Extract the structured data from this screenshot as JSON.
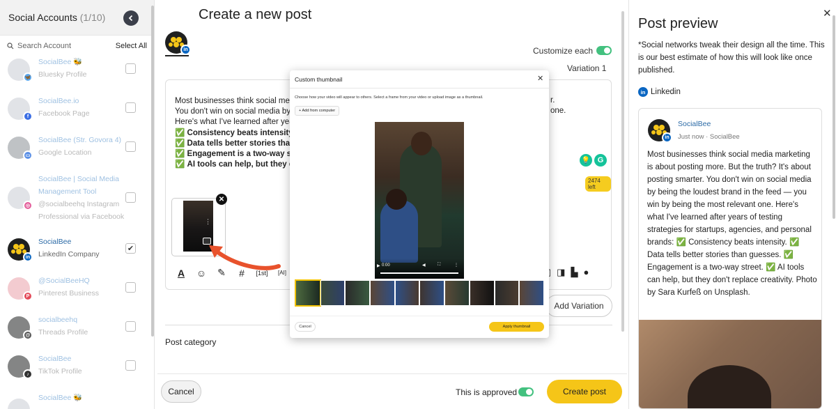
{
  "sidebar": {
    "title": "Social Accounts",
    "count": "(1/10)",
    "search_placeholder": "Search Account",
    "select_all": "Select All",
    "accounts": [
      {
        "name": "SocialBee 🐝",
        "sub": "Bluesky Profile",
        "checked": false,
        "network": "bluesky",
        "network_color": "#5aa7ee"
      },
      {
        "name": "SocialBee.io",
        "sub": "Facebook Page",
        "checked": false,
        "network": "facebook",
        "network_color": "#3b6ee4"
      },
      {
        "name": "SocialBee (Str. Govora 4)",
        "sub": "Google Location",
        "checked": false,
        "network": "google-business",
        "network_color": "#5a8fe6"
      },
      {
        "name": "SocialBee | Social Media Management Tool",
        "sub": "@socialbeehq Instagram Professional via Facebook",
        "checked": false,
        "network": "instagram",
        "network_color": "#e35c9a"
      },
      {
        "name": "SocialBee",
        "sub": "LinkedIn Company",
        "checked": true,
        "network": "linkedin",
        "network_color": "#0a66c2",
        "glyph": "in"
      },
      {
        "name": "@SocialBeeHQ",
        "sub": "Pinterest Business",
        "checked": false,
        "network": "pinterest",
        "network_color": "#e34b5a",
        "glyph": "P"
      },
      {
        "name": "socialbeehq",
        "sub": "Threads Profile",
        "checked": false,
        "network": "threads",
        "network_color": "#555555",
        "glyph": "@"
      },
      {
        "name": "SocialBee",
        "sub": "TikTok Profile",
        "checked": false,
        "network": "tiktok",
        "network_color": "#333333",
        "glyph": "♪"
      },
      {
        "name": "SocialBee 🐝",
        "sub": "",
        "checked": false,
        "network": "x",
        "network_color": "#333333"
      }
    ]
  },
  "main": {
    "title": "Create a new post",
    "customize_label": "Customize each",
    "variation_label": "Variation 1",
    "editor_lines": [
      "Most businesses think social medi",
      "You don't win on social media by l",
      "Here's what I've learned after year"
    ],
    "editor_bold_lines": [
      "Consistency beats intensity.",
      "Data tells better stories than",
      "Engagement is a two-way stre",
      "AI tools can help, but they do"
    ],
    "editor_tail1": "r.",
    "editor_tail2": "one.",
    "chars_left": "2474 left",
    "add_variation": "Add Variation",
    "post_category": "Post category",
    "cancel": "Cancel",
    "approved_label": "This is approved",
    "create_post": "Create post"
  },
  "modal": {
    "title": "Custom thumbnail",
    "description": "Choose how your video will appear to others. Select a frame from your video or upload image as a thumbnail.",
    "add_from_computer": "+ Add from computer",
    "video_time": "0:00",
    "cancel": "Cancel",
    "apply": "Apply thumbnail"
  },
  "preview": {
    "title": "Post preview",
    "note": "*Social networks tweak their design all the time. This is our best estimate of how this will look like once published.",
    "network": "Linkedin",
    "author": "SocialBee",
    "meta": "Just now · SocialBee",
    "body": "Most businesses think social media marketing is about posting more. But the truth? It's about posting smarter. You don't win on social media by being the loudest brand in the feed — you win by being the most relevant one. Here's what I've learned after years of testing strategies for startups, agencies, and personal brands: ✅ Consistency beats intensity. ✅ Data tells better stories than guesses. ✅ Engagement is a two-way street. ✅ AI tools can help, but they don't replace creativity. Photo by Sara Kurfeß on Unsplash."
  },
  "colors": {
    "accent": "#f5c518",
    "toggle": "#43c17f",
    "link": "#2b6aa6",
    "arrow": "#e8522c"
  }
}
